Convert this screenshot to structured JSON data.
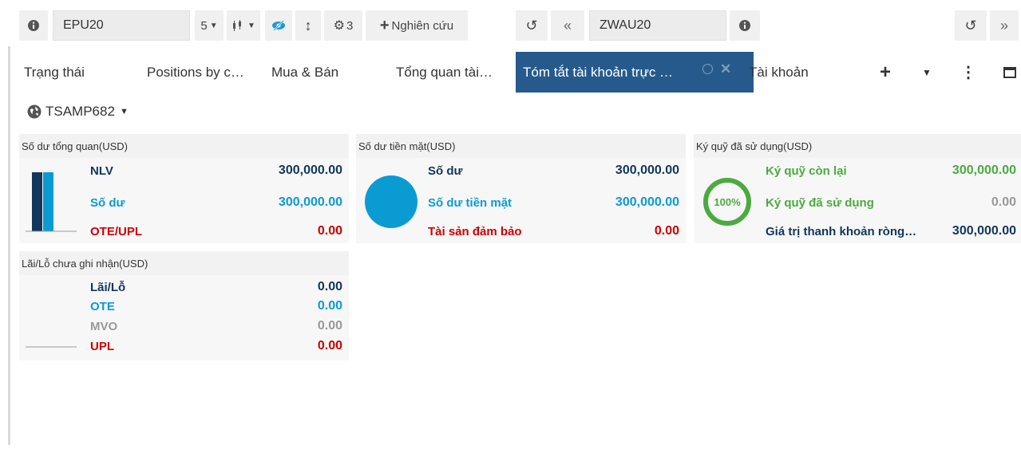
{
  "toolbar": {
    "left_symbol": "EPU20",
    "interval": "5",
    "settings_count": "3",
    "research_label": "Nghiên cứu",
    "right_symbol": "ZWAU20",
    "nav_back": "«",
    "nav_forward": "»"
  },
  "tabs": [
    {
      "label": "Trạng thái"
    },
    {
      "label": "Positions by c…"
    },
    {
      "label": "Mua & Bán"
    },
    {
      "label": "Tổng quan tài…"
    },
    {
      "label": "Tóm tắt tài khoản trực …"
    },
    {
      "label": "Tài khoản"
    }
  ],
  "account": {
    "id": "TSAMP682"
  },
  "panels": {
    "overview": {
      "title": "Số dư tổng quan(USD)",
      "rows": [
        {
          "label": "NLV",
          "value": "300,000.00"
        },
        {
          "label": "Số dư",
          "value": "300,000.00"
        },
        {
          "label": "OTE/UPL",
          "value": "0.00"
        }
      ]
    },
    "cash": {
      "title": "Số dư tiền mặt(USD)",
      "rows": [
        {
          "label": "Số dư",
          "value": "300,000.00"
        },
        {
          "label": "Số dư tiền mặt",
          "value": "300,000.00"
        },
        {
          "label": "Tài sản đảm bảo",
          "value": "0.00"
        }
      ]
    },
    "margin": {
      "title": "Ký quỹ đã sử dụng(USD)",
      "gauge_label": "100%",
      "gauge_fraction": 1.0,
      "rows": [
        {
          "label": "Ký quỹ còn lại",
          "value": "300,000.00"
        },
        {
          "label": "Ký quỹ đã sử dụng",
          "value": "0.00"
        },
        {
          "label": "Giá trị thanh khoản ròng…",
          "value": "300,000.00"
        }
      ]
    },
    "pnl": {
      "title": "Lãi/Lỗ chưa ghi nhận(USD)",
      "rows": [
        {
          "label": "Lãi/Lỗ",
          "value": "0.00"
        },
        {
          "label": "OTE",
          "value": "0.00"
        },
        {
          "label": "MVO",
          "value": "0.00"
        },
        {
          "label": "UPL",
          "value": "0.00"
        }
      ]
    }
  },
  "colors": {
    "active_tab": "#265a8c",
    "navy": "#12365c",
    "blue": "#0b9bd3",
    "red": "#cc0000",
    "green": "#4caa3f"
  }
}
